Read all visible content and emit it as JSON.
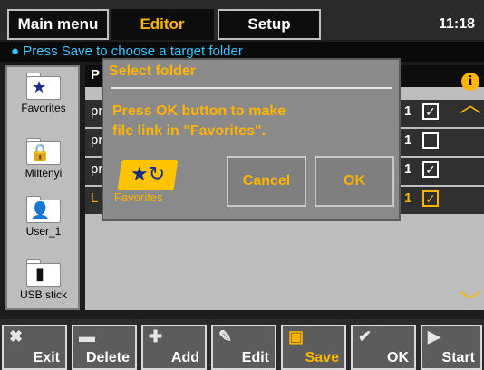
{
  "topbar": {
    "tabs": [
      {
        "label": "Main menu"
      },
      {
        "label": "Editor"
      },
      {
        "label": "Setup"
      }
    ],
    "time": "11:18"
  },
  "hint": "● Press Save to choose a target folder",
  "left_panel": {
    "items": [
      {
        "label": "Favorites",
        "icon": "star-folder-icon"
      },
      {
        "label": "Miltenyi",
        "icon": "lock-folder-icon"
      },
      {
        "label": "User_1",
        "icon": "user-folder-icon"
      },
      {
        "label": "USB stick",
        "icon": "usb-folder-icon"
      }
    ]
  },
  "list": {
    "header_partial": "P",
    "rows": [
      {
        "name_partial": "pr",
        "col": "1",
        "checked": true
      },
      {
        "name_partial": "pr",
        "col": "1",
        "checked": false
      },
      {
        "name_partial": "pr",
        "col": "1",
        "checked": true
      },
      {
        "name_partial": "L",
        "col": "1",
        "checked": true,
        "selected": true
      }
    ]
  },
  "dialog": {
    "title": "Select folder",
    "message": "Press OK button to make\nfile link in \"Favorites\".",
    "folder_label": "Favorites",
    "cancel_label": "Cancel",
    "ok_label": "OK"
  },
  "toolbar": {
    "buttons": [
      {
        "label": "Exit",
        "icon": "x-icon"
      },
      {
        "label": "Delete",
        "icon": "minus-icon"
      },
      {
        "label": "Add",
        "icon": "plus-icon"
      },
      {
        "label": "Edit",
        "icon": "edit-icon"
      },
      {
        "label": "Save",
        "icon": "save-icon"
      },
      {
        "label": "OK",
        "icon": "check-icon"
      },
      {
        "label": "Start",
        "icon": "play-icon"
      }
    ]
  },
  "colors": {
    "accent": "#ffb400",
    "hint": "#33c6ff"
  }
}
